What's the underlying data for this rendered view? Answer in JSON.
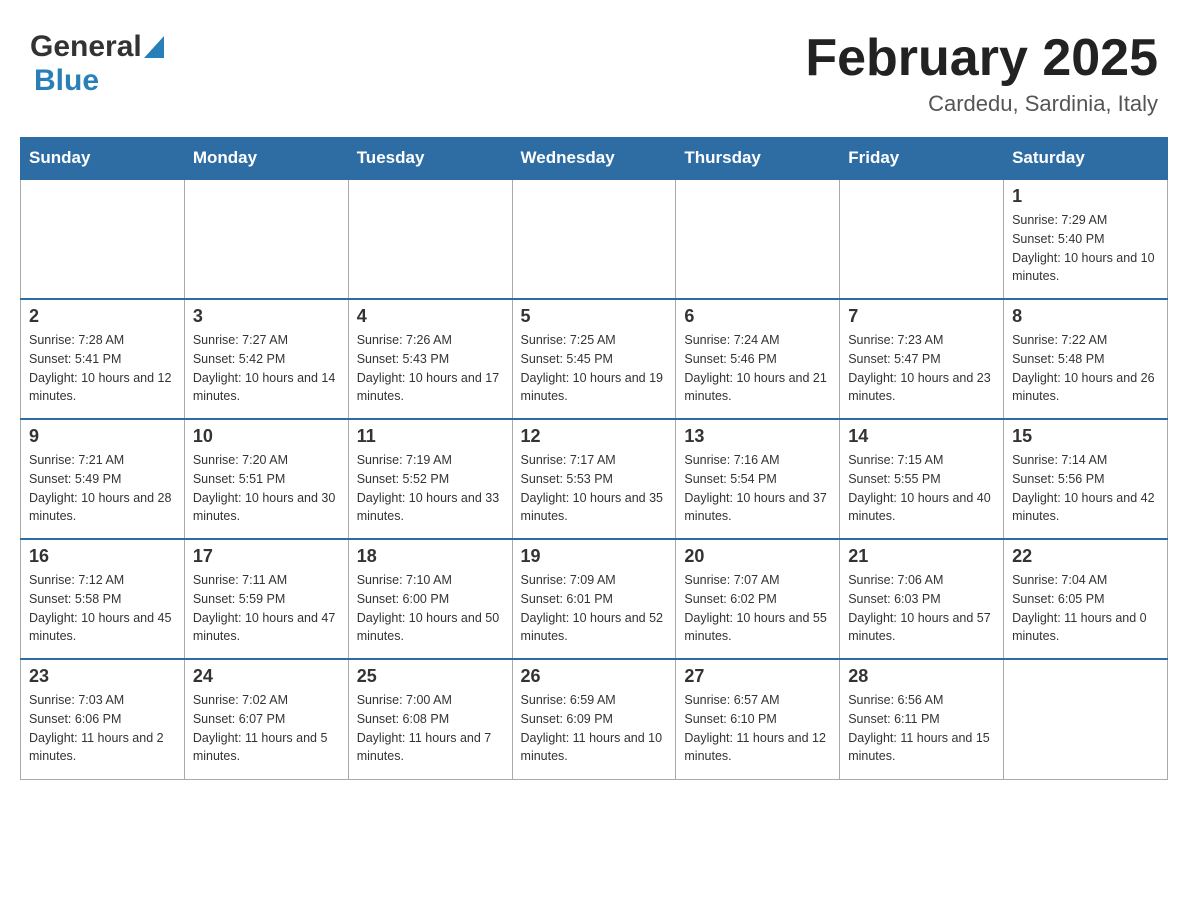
{
  "header": {
    "logo_general": "General",
    "logo_blue": "Blue",
    "title": "February 2025",
    "subtitle": "Cardedu, Sardinia, Italy"
  },
  "days_of_week": [
    "Sunday",
    "Monday",
    "Tuesday",
    "Wednesday",
    "Thursday",
    "Friday",
    "Saturday"
  ],
  "weeks": [
    [
      {
        "day": "",
        "info": ""
      },
      {
        "day": "",
        "info": ""
      },
      {
        "day": "",
        "info": ""
      },
      {
        "day": "",
        "info": ""
      },
      {
        "day": "",
        "info": ""
      },
      {
        "day": "",
        "info": ""
      },
      {
        "day": "1",
        "info": "Sunrise: 7:29 AM\nSunset: 5:40 PM\nDaylight: 10 hours and 10 minutes."
      }
    ],
    [
      {
        "day": "2",
        "info": "Sunrise: 7:28 AM\nSunset: 5:41 PM\nDaylight: 10 hours and 12 minutes."
      },
      {
        "day": "3",
        "info": "Sunrise: 7:27 AM\nSunset: 5:42 PM\nDaylight: 10 hours and 14 minutes."
      },
      {
        "day": "4",
        "info": "Sunrise: 7:26 AM\nSunset: 5:43 PM\nDaylight: 10 hours and 17 minutes."
      },
      {
        "day": "5",
        "info": "Sunrise: 7:25 AM\nSunset: 5:45 PM\nDaylight: 10 hours and 19 minutes."
      },
      {
        "day": "6",
        "info": "Sunrise: 7:24 AM\nSunset: 5:46 PM\nDaylight: 10 hours and 21 minutes."
      },
      {
        "day": "7",
        "info": "Sunrise: 7:23 AM\nSunset: 5:47 PM\nDaylight: 10 hours and 23 minutes."
      },
      {
        "day": "8",
        "info": "Sunrise: 7:22 AM\nSunset: 5:48 PM\nDaylight: 10 hours and 26 minutes."
      }
    ],
    [
      {
        "day": "9",
        "info": "Sunrise: 7:21 AM\nSunset: 5:49 PM\nDaylight: 10 hours and 28 minutes."
      },
      {
        "day": "10",
        "info": "Sunrise: 7:20 AM\nSunset: 5:51 PM\nDaylight: 10 hours and 30 minutes."
      },
      {
        "day": "11",
        "info": "Sunrise: 7:19 AM\nSunset: 5:52 PM\nDaylight: 10 hours and 33 minutes."
      },
      {
        "day": "12",
        "info": "Sunrise: 7:17 AM\nSunset: 5:53 PM\nDaylight: 10 hours and 35 minutes."
      },
      {
        "day": "13",
        "info": "Sunrise: 7:16 AM\nSunset: 5:54 PM\nDaylight: 10 hours and 37 minutes."
      },
      {
        "day": "14",
        "info": "Sunrise: 7:15 AM\nSunset: 5:55 PM\nDaylight: 10 hours and 40 minutes."
      },
      {
        "day": "15",
        "info": "Sunrise: 7:14 AM\nSunset: 5:56 PM\nDaylight: 10 hours and 42 minutes."
      }
    ],
    [
      {
        "day": "16",
        "info": "Sunrise: 7:12 AM\nSunset: 5:58 PM\nDaylight: 10 hours and 45 minutes."
      },
      {
        "day": "17",
        "info": "Sunrise: 7:11 AM\nSunset: 5:59 PM\nDaylight: 10 hours and 47 minutes."
      },
      {
        "day": "18",
        "info": "Sunrise: 7:10 AM\nSunset: 6:00 PM\nDaylight: 10 hours and 50 minutes."
      },
      {
        "day": "19",
        "info": "Sunrise: 7:09 AM\nSunset: 6:01 PM\nDaylight: 10 hours and 52 minutes."
      },
      {
        "day": "20",
        "info": "Sunrise: 7:07 AM\nSunset: 6:02 PM\nDaylight: 10 hours and 55 minutes."
      },
      {
        "day": "21",
        "info": "Sunrise: 7:06 AM\nSunset: 6:03 PM\nDaylight: 10 hours and 57 minutes."
      },
      {
        "day": "22",
        "info": "Sunrise: 7:04 AM\nSunset: 6:05 PM\nDaylight: 11 hours and 0 minutes."
      }
    ],
    [
      {
        "day": "23",
        "info": "Sunrise: 7:03 AM\nSunset: 6:06 PM\nDaylight: 11 hours and 2 minutes."
      },
      {
        "day": "24",
        "info": "Sunrise: 7:02 AM\nSunset: 6:07 PM\nDaylight: 11 hours and 5 minutes."
      },
      {
        "day": "25",
        "info": "Sunrise: 7:00 AM\nSunset: 6:08 PM\nDaylight: 11 hours and 7 minutes."
      },
      {
        "day": "26",
        "info": "Sunrise: 6:59 AM\nSunset: 6:09 PM\nDaylight: 11 hours and 10 minutes."
      },
      {
        "day": "27",
        "info": "Sunrise: 6:57 AM\nSunset: 6:10 PM\nDaylight: 11 hours and 12 minutes."
      },
      {
        "day": "28",
        "info": "Sunrise: 6:56 AM\nSunset: 6:11 PM\nDaylight: 11 hours and 15 minutes."
      },
      {
        "day": "",
        "info": ""
      }
    ]
  ]
}
